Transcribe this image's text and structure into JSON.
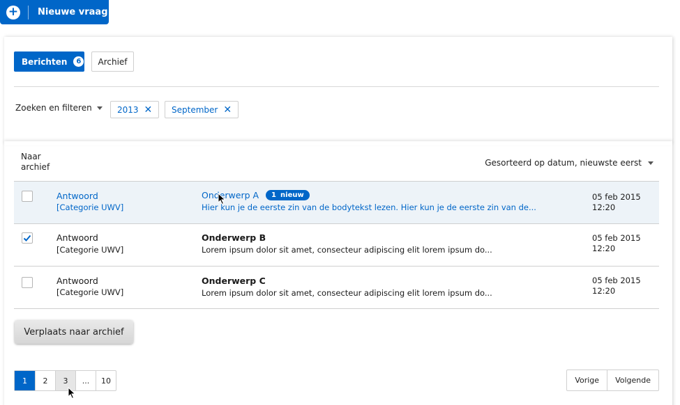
{
  "new_question_label": "Nieuwe vraag",
  "tabs": {
    "messages_label": "Berichten",
    "messages_count": "6",
    "archive_label": "Archief"
  },
  "filters": {
    "toggle_label": "Zoeken en filteren",
    "chips": [
      {
        "label": "2013"
      },
      {
        "label": "September"
      }
    ]
  },
  "list": {
    "move_to_archive_header": "Naar archief",
    "sort_label": "Gesorteerd op datum, nieuwste eerst",
    "rows": [
      {
        "from": "Antwoord",
        "category": "[Categorie UWV]",
        "subject": "Onderwerp A",
        "badge_count": "1",
        "badge_label": "nieuw",
        "body": "Hier kun je de eerste zin van de bodytekst lezen. Hier kun je de eerste zin van de...",
        "date": "05 feb 2015",
        "time": "12:20",
        "checked": false
      },
      {
        "from": "Antwoord",
        "category": "[Categorie UWV]",
        "subject": "Onderwerp B",
        "body": "Lorem ipsum dolor sit amet, consecteur adipiscing elit lorem ipsum do...",
        "date": "05 feb 2015",
        "time": "12:20",
        "checked": true
      },
      {
        "from": "Antwoord",
        "category": "[Categorie UWV]",
        "subject": "Onderwerp C",
        "body": "Lorem ipsum dolor sit amet, consecteur adipiscing elit lorem ipsum do...",
        "date": "05 feb 2015",
        "time": "12:20",
        "checked": false
      }
    ]
  },
  "move_button_label": "Verplaats naar archief",
  "pagination": {
    "pages": [
      "1",
      "2",
      "3",
      "...",
      "10"
    ],
    "active_page": "1",
    "prev_label": "Vorige",
    "next_label": "Volgende"
  },
  "colors": {
    "accent": "#0066c8",
    "row_highlight": "#edf3f8"
  },
  "icons": {
    "new": "plus-icon",
    "remove_filter": "close-icon",
    "dropdown": "caret-down-icon",
    "check": "check-icon",
    "cursor": "mouse-pointer-icon"
  }
}
